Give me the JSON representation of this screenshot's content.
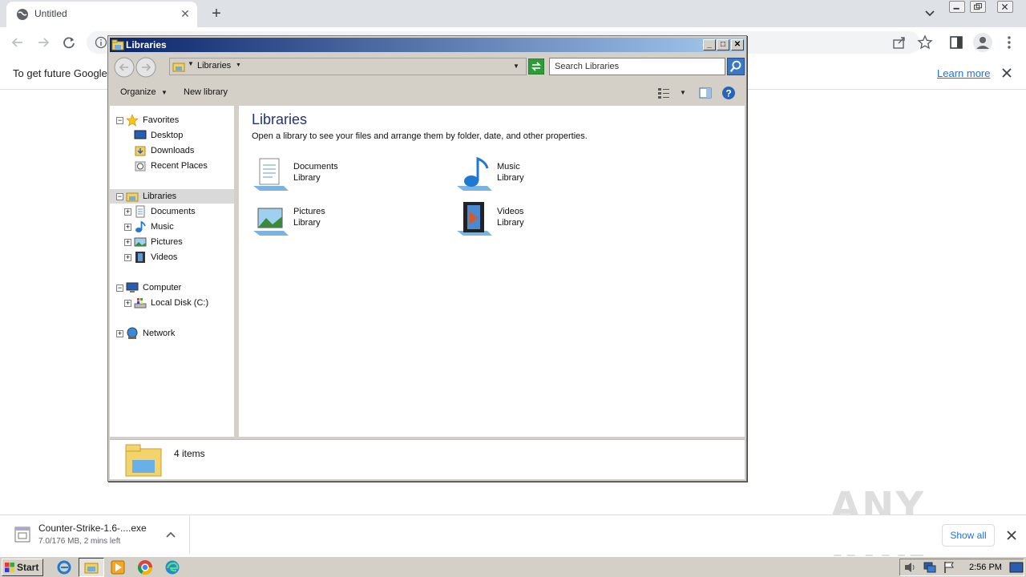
{
  "browser": {
    "tab_title": "Untitled",
    "infobar_text": "To get future Google",
    "learn_more": "Learn more"
  },
  "explorer": {
    "window_title": "Libraries",
    "address": "Libraries",
    "search_placeholder": "Search Libraries",
    "commands": {
      "organize": "Organize",
      "new_library": "New library"
    },
    "nav": {
      "favorites": "Favorites",
      "desktop": "Desktop",
      "downloads": "Downloads",
      "recent_places": "Recent Places",
      "libraries": "Libraries",
      "documents": "Documents",
      "music": "Music",
      "pictures": "Pictures",
      "videos": "Videos",
      "computer": "Computer",
      "local_disk": "Local Disk (C:)",
      "network": "Network"
    },
    "content": {
      "title": "Libraries",
      "subtitle": "Open a library to see your files and arrange them by folder, date, and other properties.",
      "libraries": [
        {
          "name": "Documents",
          "type": "Library"
        },
        {
          "name": "Music",
          "type": "Library"
        },
        {
          "name": "Pictures",
          "type": "Library"
        },
        {
          "name": "Videos",
          "type": "Library"
        }
      ]
    },
    "details": "4 items"
  },
  "download": {
    "filename": "Counter-Strike-1.6-....exe",
    "status": "7.0/176 MB, 2 mins left",
    "show_all": "Show all"
  },
  "watermark": "ANY RUN",
  "taskbar": {
    "start": "Start",
    "clock": "2:56 PM"
  },
  "colors": {
    "title_start": "#0a246a",
    "title_end": "#a6caf0",
    "link": "#1a73e8",
    "content_title": "#1e3287"
  }
}
